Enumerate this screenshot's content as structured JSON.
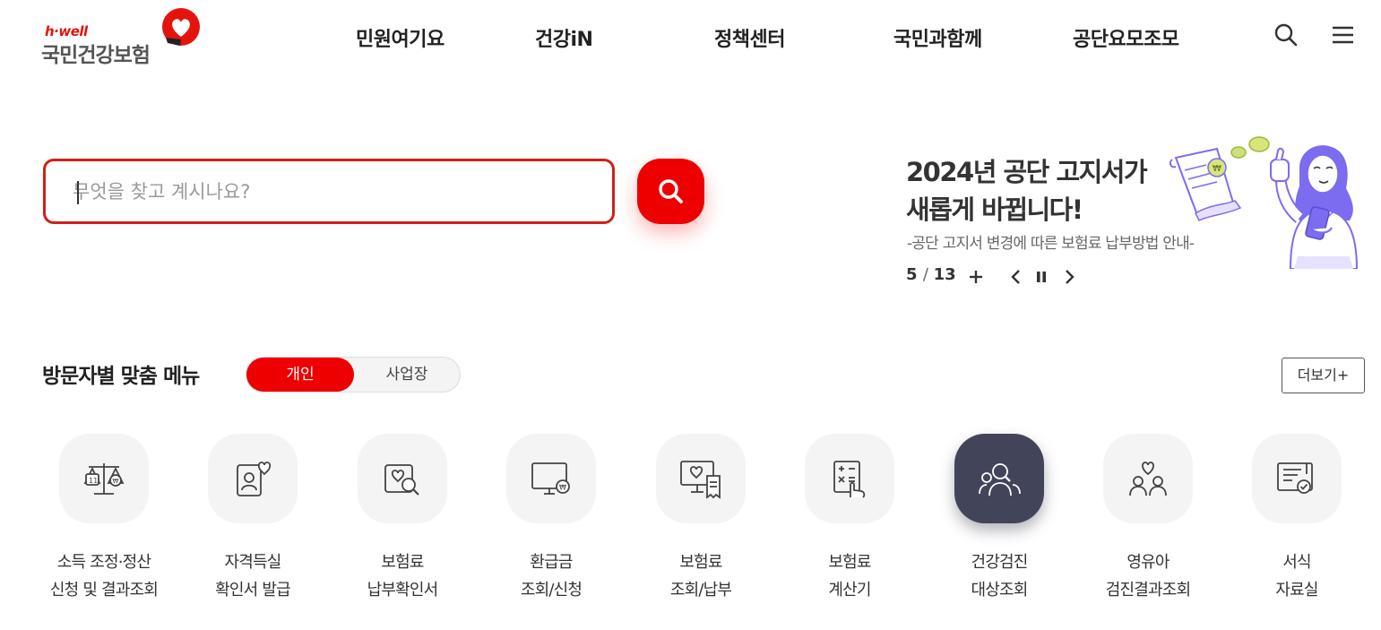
{
  "header": {
    "logo_en": "h·well",
    "logo_ko": "국민건강보험",
    "nav": [
      "민원여기요",
      "건강iN",
      "정책센터",
      "국민과함께",
      "공단요모조모"
    ],
    "icons": [
      "search-icon",
      "hamburger-menu-icon"
    ]
  },
  "search": {
    "placeholder": "무엇을 찾고 계시나요?",
    "value": "",
    "button_icon": "search-icon"
  },
  "banner": {
    "title_line1": "2024년 공단 고지서가",
    "title_line2": "새롭게 바뀝니다!",
    "subtitle": "-공단 고지서 변경에 따른 보험료 납부방법 안내-",
    "current": "5",
    "total": "13",
    "controls": [
      "plus-icon",
      "chevron-left-icon",
      "pause-icon",
      "chevron-right-icon"
    ]
  },
  "menu_section": {
    "title": "방문자별 맞춤 메뉴",
    "toggle_active": "개인",
    "toggle_inactive": "사업장",
    "more": "더보기+",
    "items": [
      {
        "line1": "소득 조정·정산",
        "line2": "신청 및 결과조회",
        "icon": "scale-calendar-icon",
        "active": false
      },
      {
        "line1": "자격득실",
        "line2": "확인서 발급",
        "icon": "id-card-heart-icon",
        "active": false
      },
      {
        "line1": "보험료",
        "line2": "납부확인서",
        "icon": "document-search-icon",
        "active": false
      },
      {
        "line1": "환급금",
        "line2": "조회/신청",
        "icon": "monitor-won-icon",
        "active": false
      },
      {
        "line1": "보험료",
        "line2": "조회/납부",
        "icon": "monitor-receipt-icon",
        "active": false
      },
      {
        "line1": "보험료",
        "line2": "계산기",
        "icon": "calculator-hand-icon",
        "active": false
      },
      {
        "line1": "건강검진",
        "line2": "대상조회",
        "icon": "people-search-icon",
        "active": true
      },
      {
        "line1": "영유아",
        "line2": "검진결과조회",
        "icon": "family-heart-icon",
        "active": false
      },
      {
        "line1": "서식",
        "line2": "자료실",
        "icon": "form-check-icon",
        "active": false
      }
    ]
  },
  "colors": {
    "brand_red": "#ef0000",
    "search_border": "#d21f17",
    "active_menu_bg": "#42455a",
    "menu_bg": "#f4f4f4",
    "illustration_purple": "#7b6cf0"
  }
}
